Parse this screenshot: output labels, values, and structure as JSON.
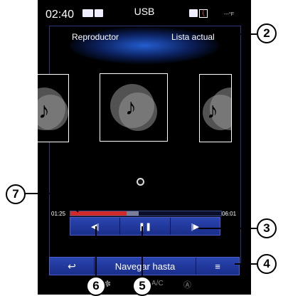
{
  "status_bar": {
    "time": "02:40",
    "source_title": "USB",
    "temperature": "---°F"
  },
  "tabs": {
    "player": "Reproductor",
    "current_list": "Lista actual"
  },
  "covers": {
    "placeholder_icon": "music-note-icon"
  },
  "progress": {
    "elapsed": "01:25",
    "total": "06:01",
    "fraction": 0.39
  },
  "controls": {
    "previous_icon": "◀|",
    "play_pause_icon": "❚❚",
    "next_icon": "|▶"
  },
  "nav_bar": {
    "back_icon": "↩",
    "navigate_label": "Navegar hasta",
    "list_icon": "≡"
  },
  "bottom": {
    "ac_label": "A/C"
  },
  "callouts": {
    "c2": "2",
    "c3": "3",
    "c4": "4",
    "c5": "5",
    "c6": "6",
    "c7": "7"
  },
  "colors": {
    "screen_bg": "#000000",
    "accent_blue": "#2a46b0",
    "progress_red": "#d02a2a"
  }
}
